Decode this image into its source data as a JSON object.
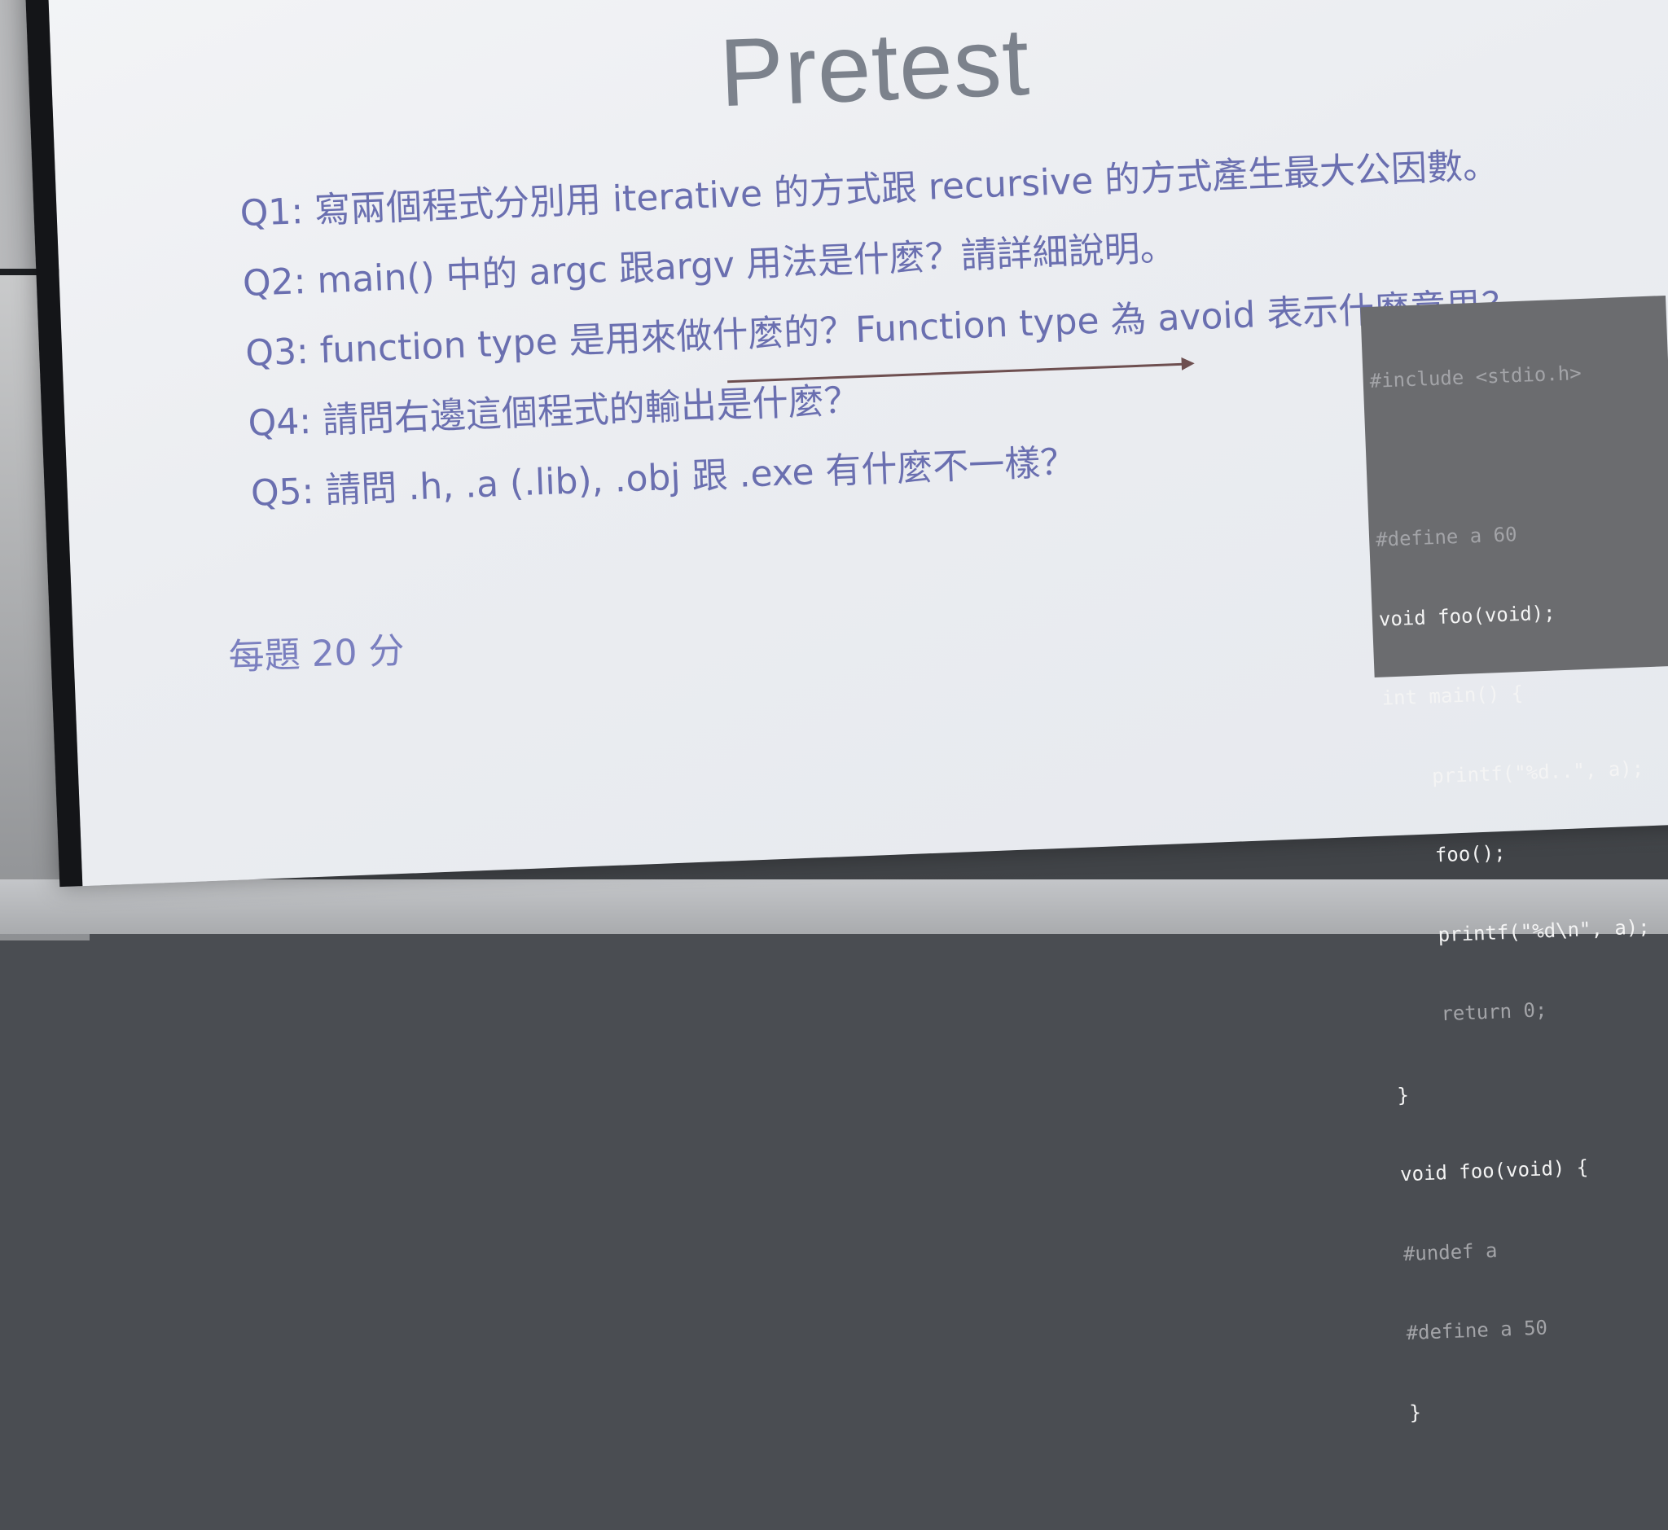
{
  "slide": {
    "title": "Pretest",
    "questions": [
      "Q1: 寫兩個程式分別用 iterative 的方式跟 recursive 的方式產生最大公因數。",
      "Q2: main() 中的 argc 跟argv 用法是什麼？請詳細說明。",
      "Q3: function type 是用來做什麼的？Function type 為 avoid 表示什麼意思？",
      "Q4: 請問右邊這個程式的輸出是什麼？",
      "Q5: 請問 .h, .a (.lib), .obj 跟 .exe 有什麼不一樣？"
    ],
    "score_note": "每題 20 分",
    "code_lines": [
      "#include <stdio.h>",
      "",
      "#define a 60",
      "void foo(void);",
      "int main() {",
      "    printf(\"%d..\", a);",
      "    foo();",
      "    printf(\"%d\\n\", a);",
      "    return 0;",
      "}",
      "void foo(void) {",
      "#undef a",
      "#define a 50",
      "}"
    ]
  },
  "colors": {
    "title": "#7c828c",
    "question_text": "#6a6fb0",
    "code_background": "#6b6c6f",
    "arrow": "#6e4f50"
  }
}
